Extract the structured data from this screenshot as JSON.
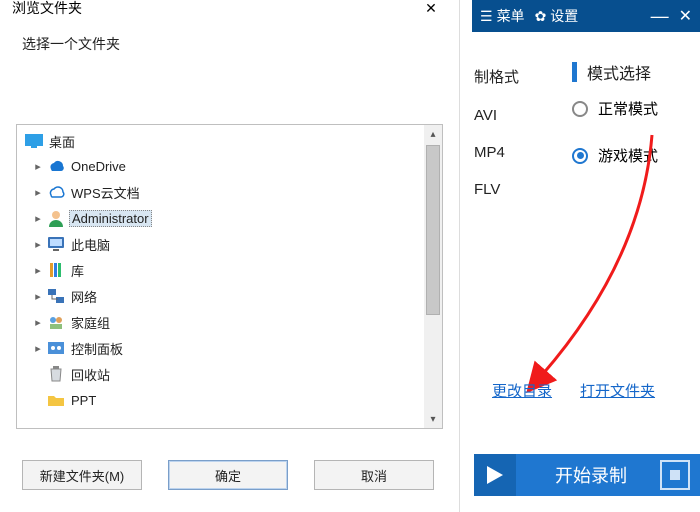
{
  "dialog": {
    "title": "浏览文件夹",
    "prompt": "选择一个文件夹",
    "tree": {
      "root": "桌面",
      "items": [
        "OneDrive",
        "WPS云文档",
        "Administrator",
        "此电脑",
        "库",
        "网络",
        "家庭组",
        "控制面板",
        "回收站",
        "PPT"
      ],
      "selected_index": 2
    },
    "buttons": {
      "new_folder": "新建文件夹(M)",
      "ok": "确定",
      "cancel": "取消"
    }
  },
  "app": {
    "titlebar": {
      "menu": "菜单",
      "settings": "设置"
    },
    "format_heading": "制格式",
    "formats": [
      "AVI",
      "MP4",
      "FLV"
    ],
    "mode_heading": "模式选择",
    "modes": [
      "正常模式",
      "游戏模式"
    ],
    "selected_mode_index": 1,
    "links": {
      "change_dir": "更改目录",
      "open_folder": "打开文件夹"
    },
    "record_label": "开始录制"
  }
}
